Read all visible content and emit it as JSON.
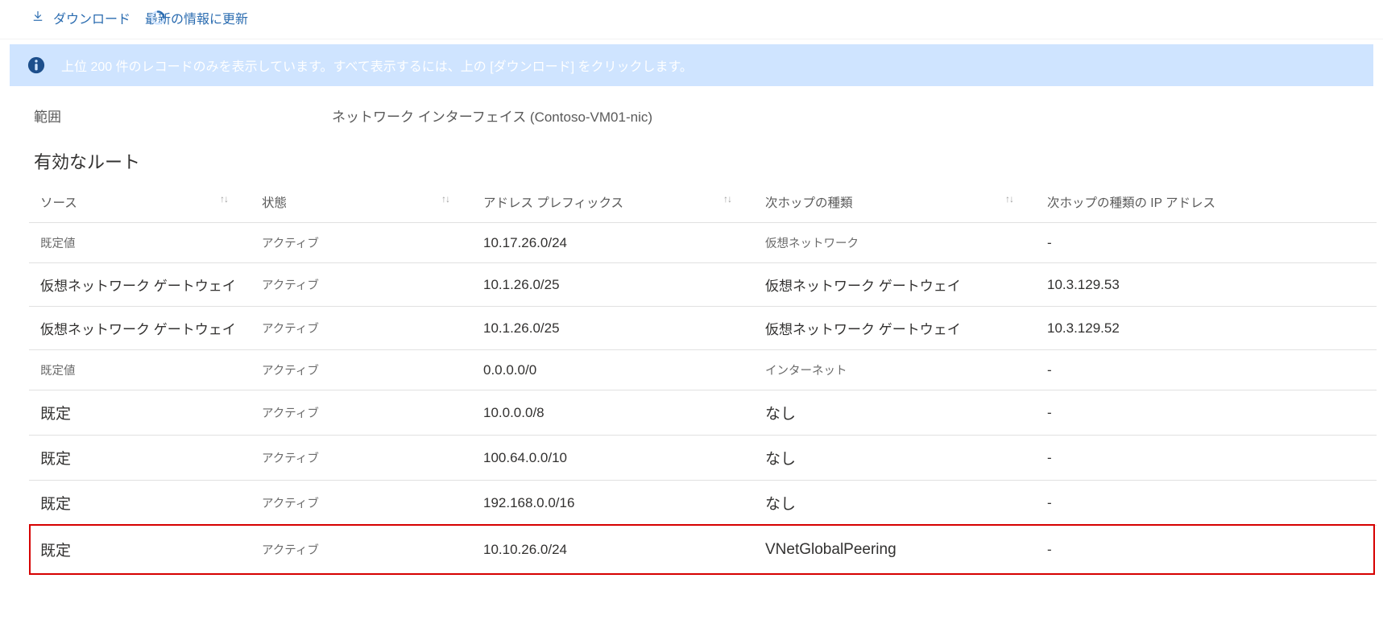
{
  "toolbar": {
    "download_label": "ダウンロード",
    "refresh_label": "最新の情報に更新"
  },
  "banner": {
    "text": "上位 200 件のレコードのみを表示しています。すべて表示するには、上の [ダウンロード] をクリックします。"
  },
  "scope": {
    "label": "範囲",
    "value": "ネットワーク インターフェイス (Contoso-VM01-nic)"
  },
  "section_title": "有効なルート",
  "columns": {
    "source": "ソース",
    "state": "状態",
    "prefix": "アドレス プレフィックス",
    "next_hop_type": "次ホップの種類",
    "next_hop_ip": "次ホップの種類の IP アドレス"
  },
  "rows": [
    {
      "size": "small",
      "source": "既定値",
      "state": "アクティブ",
      "prefix": "10.17.26.0/24",
      "next_hop_type": "仮想ネットワーク",
      "next_hop_ip": "-"
    },
    {
      "size": "normal",
      "source": "仮想ネットワーク ゲートウェイ",
      "state": "アクティブ",
      "prefix": "10.1.26.0/25",
      "next_hop_type": "仮想ネットワーク ゲートウェイ",
      "next_hop_ip": "10.3.129.53"
    },
    {
      "size": "normal",
      "source": "仮想ネットワーク ゲートウェイ",
      "state": "アクティブ",
      "prefix": "10.1.26.0/25",
      "next_hop_type": "仮想ネットワーク ゲートウェイ",
      "next_hop_ip": "10.3.129.52"
    },
    {
      "size": "small",
      "source": "既定値",
      "state": "アクティブ",
      "prefix": "0.0.0.0/0",
      "next_hop_type": "インターネット",
      "next_hop_ip": "-"
    },
    {
      "size": "large",
      "source": "既定",
      "state": "アクティブ",
      "prefix": "10.0.0.0/8",
      "next_hop_type": "なし",
      "next_hop_ip": "-"
    },
    {
      "size": "large",
      "source": "既定",
      "state": "アクティブ",
      "prefix": "100.64.0.0/10",
      "next_hop_type": "なし",
      "next_hop_ip": "-"
    },
    {
      "size": "large",
      "source": "既定",
      "state": "アクティブ",
      "prefix": "192.168.0.0/16",
      "next_hop_type": "なし",
      "next_hop_ip": "-"
    },
    {
      "size": "large",
      "source": "既定",
      "state": "アクティブ",
      "prefix": "10.10.26.0/24",
      "next_hop_type": "VNetGlobalPeering",
      "next_hop_ip": "-",
      "highlight": true
    }
  ]
}
